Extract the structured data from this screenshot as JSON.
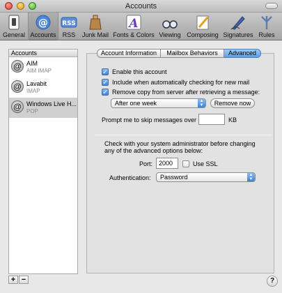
{
  "window": {
    "title": "Accounts"
  },
  "toolbar": {
    "items": [
      {
        "label": "General",
        "icon": "light-switch-icon"
      },
      {
        "label": "Accounts",
        "icon": "at-sign-icon"
      },
      {
        "label": "RSS",
        "icon": "rss-badge-icon"
      },
      {
        "label": "Junk Mail",
        "icon": "trash-bag-icon"
      },
      {
        "label": "Fonts & Colors",
        "icon": "font-a-icon"
      },
      {
        "label": "Viewing",
        "icon": "eyeglasses-icon"
      },
      {
        "label": "Composing",
        "icon": "pencil-paper-icon"
      },
      {
        "label": "Signatures",
        "icon": "pen-nib-icon"
      },
      {
        "label": "Rules",
        "icon": "funnel-arrows-icon"
      }
    ],
    "selected": "Accounts"
  },
  "sidebar": {
    "header": "Accounts",
    "accounts": [
      {
        "name": "AIM",
        "type": "AIM IMAP",
        "icon": "at-sign-icon"
      },
      {
        "name": "Lavabit",
        "type": "IMAP",
        "icon": "at-sign-icon"
      },
      {
        "name": "Windows Live H...",
        "type": "POP",
        "icon": "at-sign-icon",
        "selected": true
      }
    ],
    "add_label": "+",
    "remove_label": "−"
  },
  "tabs": {
    "items": [
      "Account Information",
      "Mailbox Behaviors",
      "Advanced"
    ],
    "active": "Advanced"
  },
  "advanced": {
    "enable_account": {
      "label": "Enable this account",
      "checked": true
    },
    "include_check": {
      "label": "Include when automatically checking for new mail",
      "checked": true
    },
    "remove_copy": {
      "label": "Remove copy from server after retrieving a message:",
      "checked": true
    },
    "remove_after": {
      "value": "After one week"
    },
    "remove_now_label": "Remove now",
    "skip_label": "Prompt me to skip messages over",
    "skip_value": "",
    "skip_unit": "KB",
    "admin_note_1": "Check with your system administrator before changing",
    "admin_note_2": "any of the advanced options below:",
    "port_label": "Port:",
    "port_value": "2000",
    "ssl": {
      "label": "Use SSL",
      "checked": false
    },
    "auth_label": "Authentication:",
    "auth_value": "Password"
  },
  "help_label": "?",
  "colors": {
    "accent": "#5d9fe6",
    "toolbar": "#b5b5b5"
  }
}
